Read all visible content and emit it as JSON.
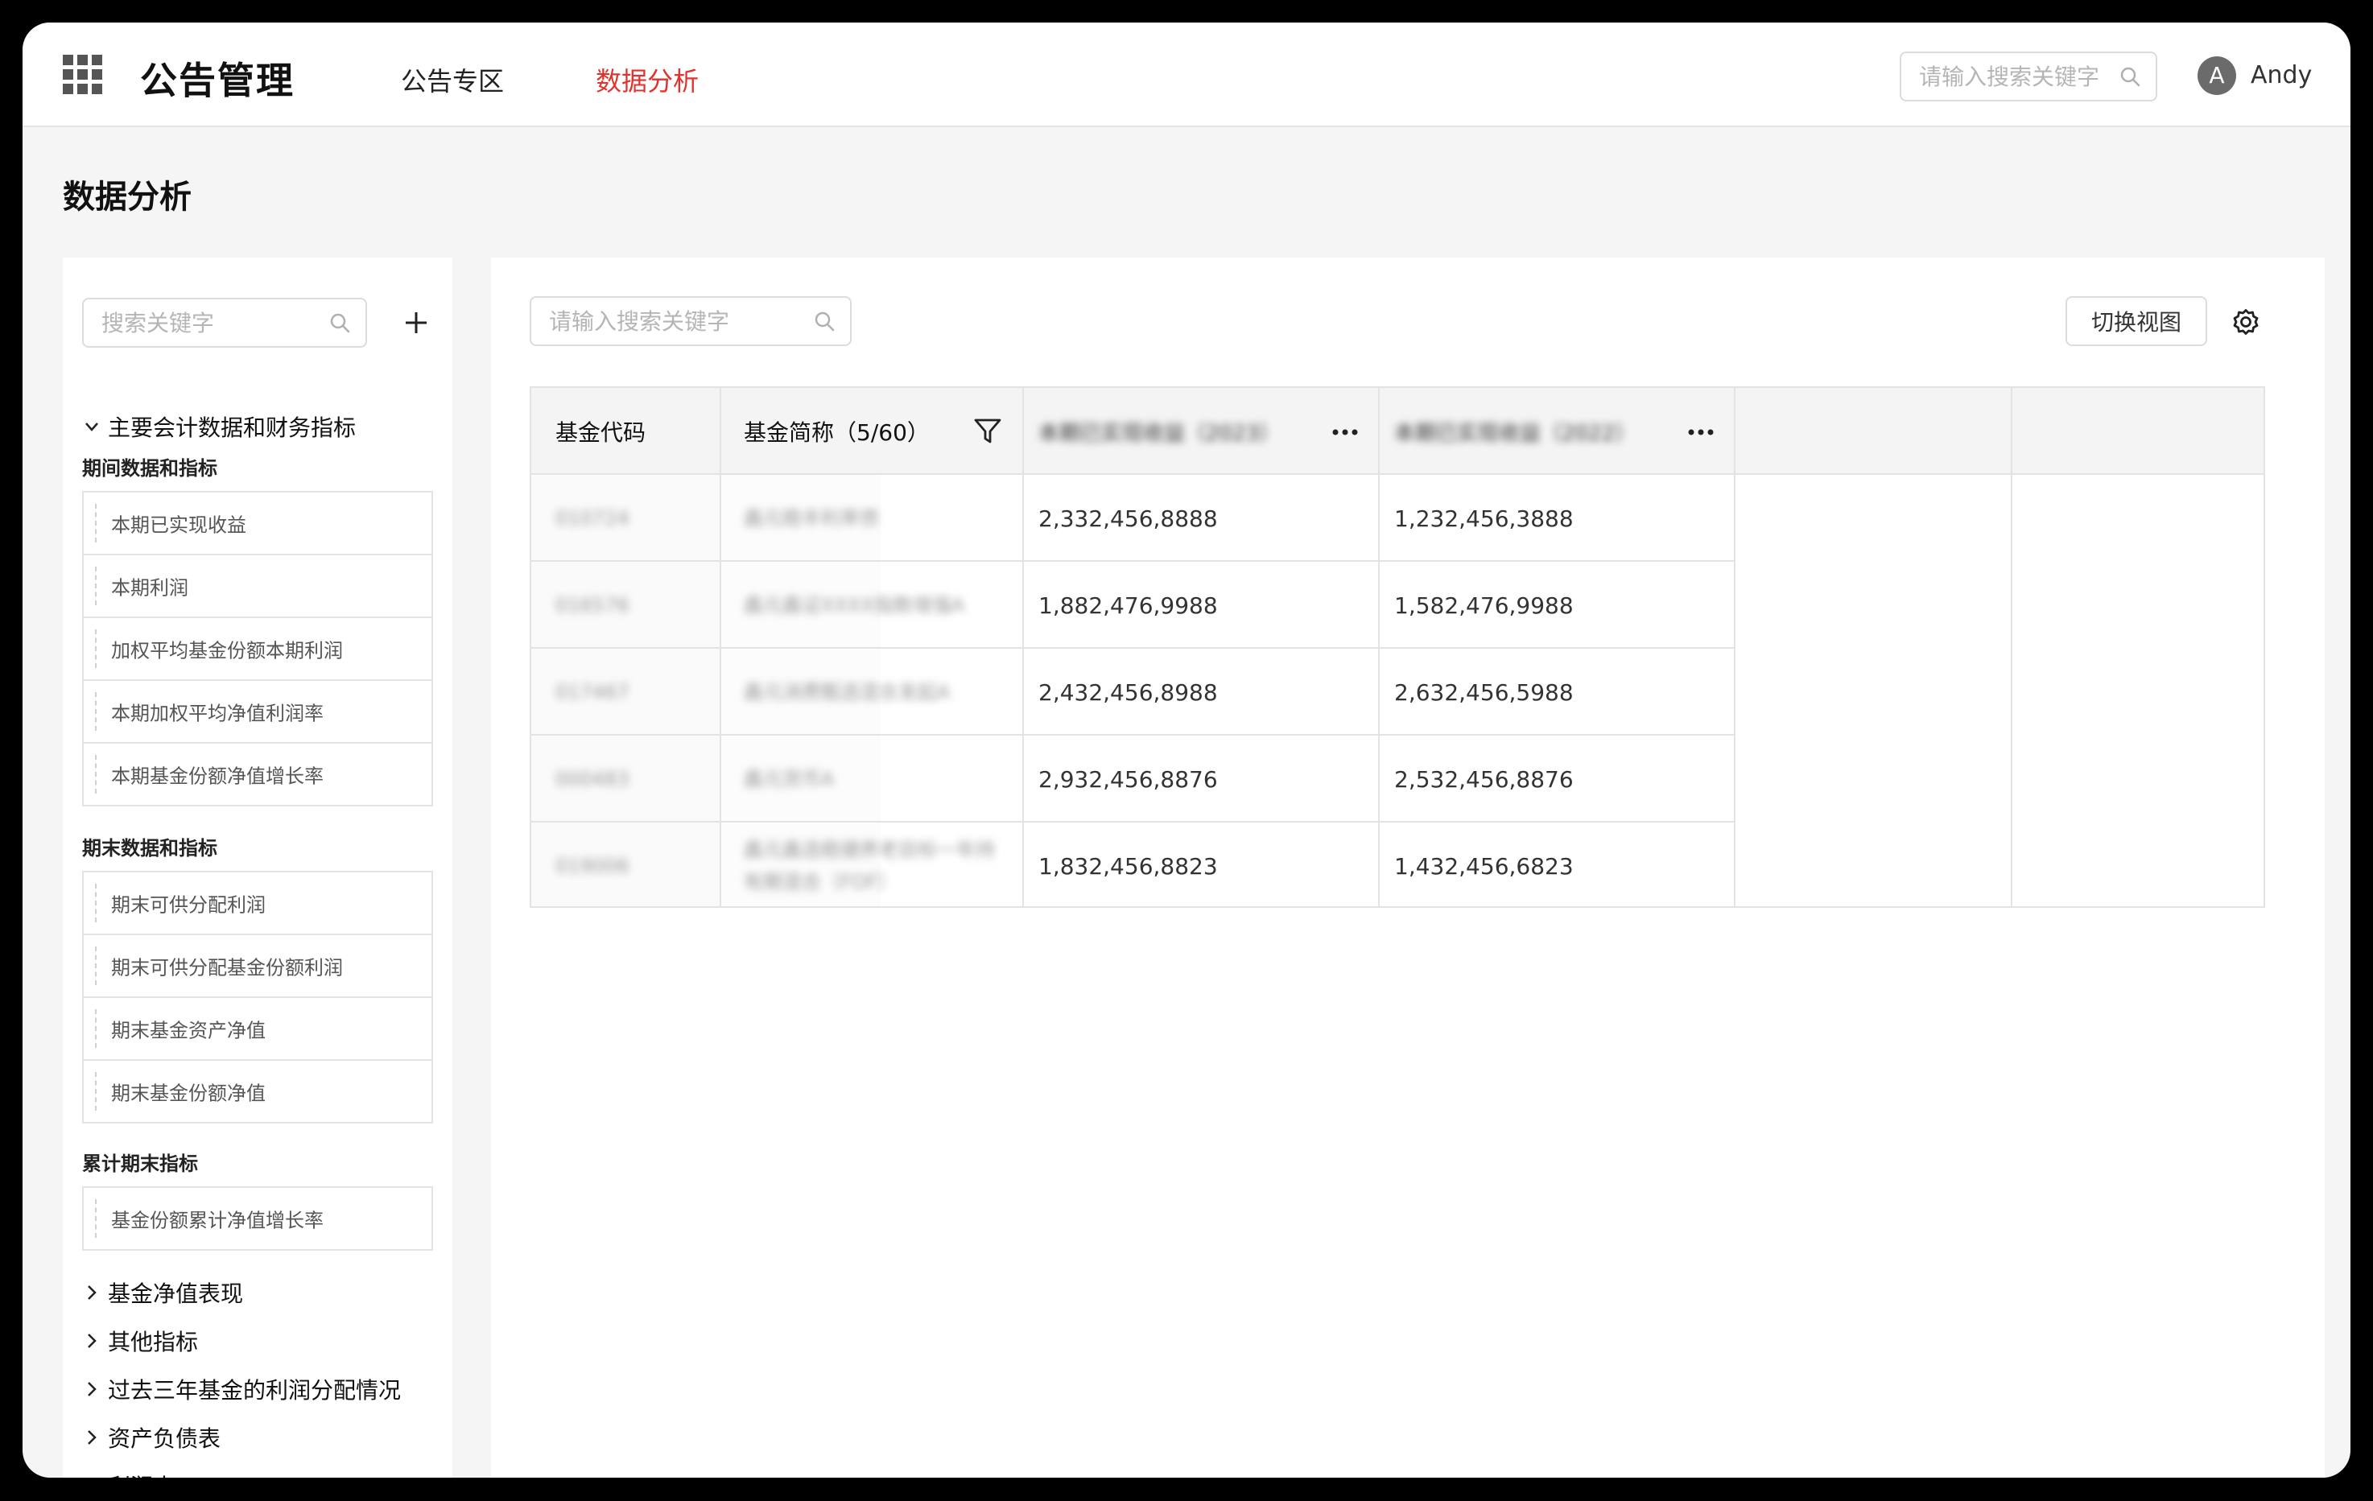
{
  "header": {
    "app_title": "公告管理",
    "nav": [
      "公告专区",
      "数据分析"
    ],
    "search_placeholder": "请输入搜索关键字",
    "user_initial": "A",
    "user_name": "Andy"
  },
  "page_title": "数据分析",
  "sidebar": {
    "search_placeholder": "搜索关键字",
    "groups": [
      {
        "title": "主要会计数据和财务指标",
        "expanded": true,
        "subgroups": [
          {
            "title": "期间数据和指标",
            "items": [
              "本期已实现收益",
              "本期利润",
              "加权平均基金份额本期利润",
              "本期加权平均净值利润率",
              "本期基金份额净值增长率"
            ]
          },
          {
            "title": "期末数据和指标",
            "items": [
              "期末可供分配利润",
              "期末可供分配基金份额利润",
              "期末基金资产净值",
              "期末基金份额净值"
            ]
          },
          {
            "title": "累计期末指标",
            "items": [
              "基金份额累计净值增长率"
            ]
          }
        ]
      },
      {
        "title": "基金净值表现",
        "expanded": false
      },
      {
        "title": "其他指标",
        "expanded": false
      },
      {
        "title": "过去三年基金的利润分配情况",
        "expanded": false
      },
      {
        "title": "资产负债表",
        "expanded": false
      },
      {
        "title": "利润表",
        "expanded": false
      }
    ]
  },
  "table": {
    "search_placeholder": "请输入搜索关键字",
    "switch_view_label": "切换视图",
    "columns": {
      "code": "基金代码",
      "name": "基金简称（5/60）",
      "metric_2023": "本期已实现收益（2023）",
      "metric_2022": "本期已实现收益（2022）"
    },
    "rows": [
      {
        "code": "010724",
        "name": "鑫元稳丰利率债",
        "v2023": "2,332,456,8888",
        "v2022": "1,232,456,3888"
      },
      {
        "code": "016576",
        "name": "鑫元鑫证XXXX指数增强A",
        "v2023": "1,882,476,9988",
        "v2022": "1,582,476,9988"
      },
      {
        "code": "017467",
        "name": "鑫元消费甄选混合发起A",
        "v2023": "2,432,456,8988",
        "v2022": "2,632,456,5988"
      },
      {
        "code": "000483",
        "name": "鑫元货币A",
        "v2023": "2,932,456,8876",
        "v2022": "2,532,456,8876"
      },
      {
        "code": "019006",
        "name": "鑫元鑫选稳健养老目标一年持有期混合（FOF）",
        "v2023": "1,832,456,8823",
        "v2022": "1,432,456,6823"
      }
    ]
  },
  "colors": {
    "accent": "#e0332e",
    "border": "#e3e3e3",
    "bg": "#f5f5f5"
  },
  "icons": [
    "apps-grid-icon",
    "search-icon",
    "plus-icon",
    "chevron-down-icon",
    "chevron-right-icon",
    "filter-icon",
    "more-icon",
    "gear-icon"
  ]
}
